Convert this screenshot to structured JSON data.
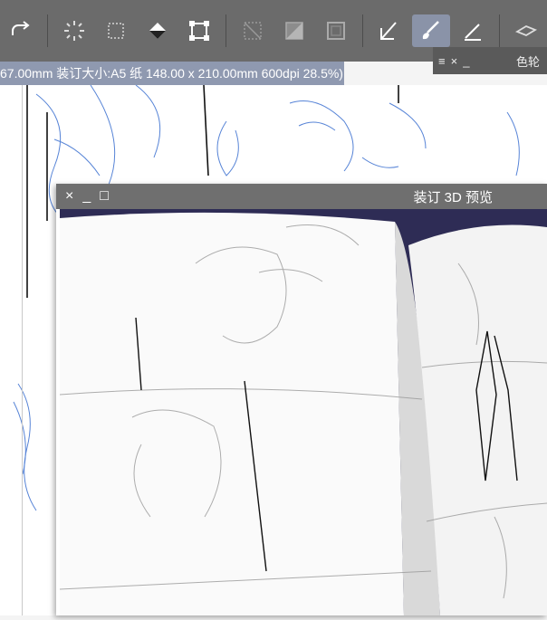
{
  "toolbar": {
    "buttons": [
      {
        "icon": "redo-icon"
      },
      {
        "icon": "loading-icon"
      },
      {
        "icon": "dotted-square-icon"
      },
      {
        "icon": "fill-icon"
      },
      {
        "icon": "transform-icon"
      },
      {
        "icon": "select-off-icon"
      },
      {
        "icon": "select-invert-icon"
      },
      {
        "icon": "frame-icon"
      },
      {
        "icon": "pen-select-icon"
      },
      {
        "icon": "brush-icon"
      },
      {
        "icon": "pen-icon"
      },
      {
        "icon": "hat-icon"
      }
    ]
  },
  "document_title": "67.00mm 装订大小:A5 纸 148.00 x 210.00mm 600dpi 28.5%)",
  "palette": {
    "menu_icon": "≡",
    "close_icon": "×",
    "minimize_icon": "_",
    "label": "色轮"
  },
  "preview_window": {
    "close_icon": "×",
    "minimize_icon": "_",
    "maximize_icon": "□",
    "title": "装订 3D 预览"
  },
  "colors": {
    "toolbar": "#6b6b6b",
    "title_bar": "#8f99b0",
    "active_tool": "#8a93a8",
    "sketch_blue": "#3a6fd0",
    "preview_bg": "#2e2c55"
  }
}
